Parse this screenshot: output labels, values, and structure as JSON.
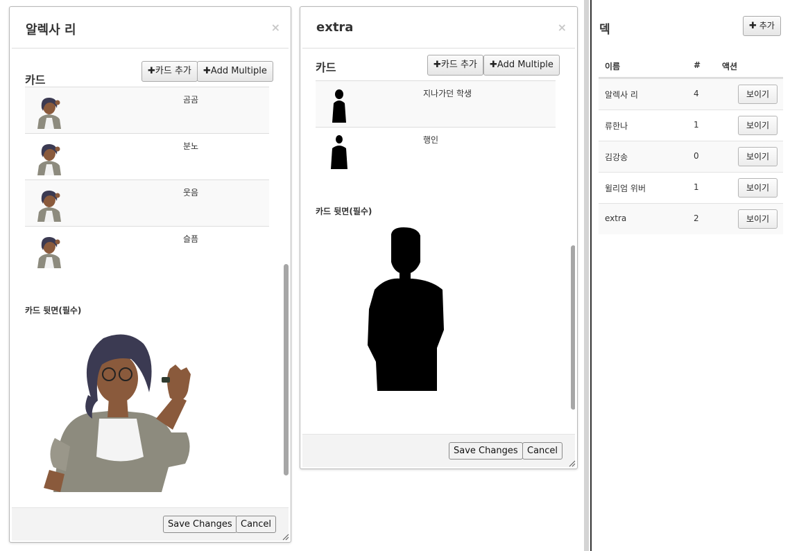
{
  "dialog1": {
    "title": "알렉사 리",
    "close": "×",
    "cards_heading": "카드",
    "add_card": "카드 추가",
    "add_multiple": "Add Multiple",
    "cards": [
      {
        "name": "곰곰"
      },
      {
        "name": "분노"
      },
      {
        "name": "웃음"
      },
      {
        "name": "슬픔"
      }
    ],
    "back_label": "카드 뒷면(필수)",
    "save": "Save Changes",
    "cancel": "Cancel"
  },
  "dialog2": {
    "title": "extra",
    "close": "×",
    "cards_heading": "카드",
    "add_card": "카드 추가",
    "add_multiple": "Add Multiple",
    "cards": [
      {
        "name": "지나가던 학생"
      },
      {
        "name": "행인"
      }
    ],
    "back_label": "카드 뒷면(필수)",
    "save": "Save Changes",
    "cancel": "Cancel"
  },
  "deck": {
    "title": "덱",
    "add_button": "추가",
    "columns": {
      "name": "이름",
      "count": "#",
      "actions": "액션"
    },
    "rows": [
      {
        "name": "알렉사 리",
        "count": "4",
        "action": "보이기"
      },
      {
        "name": "류한나",
        "count": "1",
        "action": "보이기"
      },
      {
        "name": "김강송",
        "count": "0",
        "action": "보이기"
      },
      {
        "name": "윌리엄 위버",
        "count": "1",
        "action": "보이기"
      },
      {
        "name": "extra",
        "count": "2",
        "action": "보이기"
      }
    ]
  },
  "colors": {
    "silhouette": "#000000",
    "skin": "#8a5a3c",
    "hair": "#3b3a52",
    "jacket": "#8d8b7e",
    "footer_bg": "#f3f3f3"
  }
}
